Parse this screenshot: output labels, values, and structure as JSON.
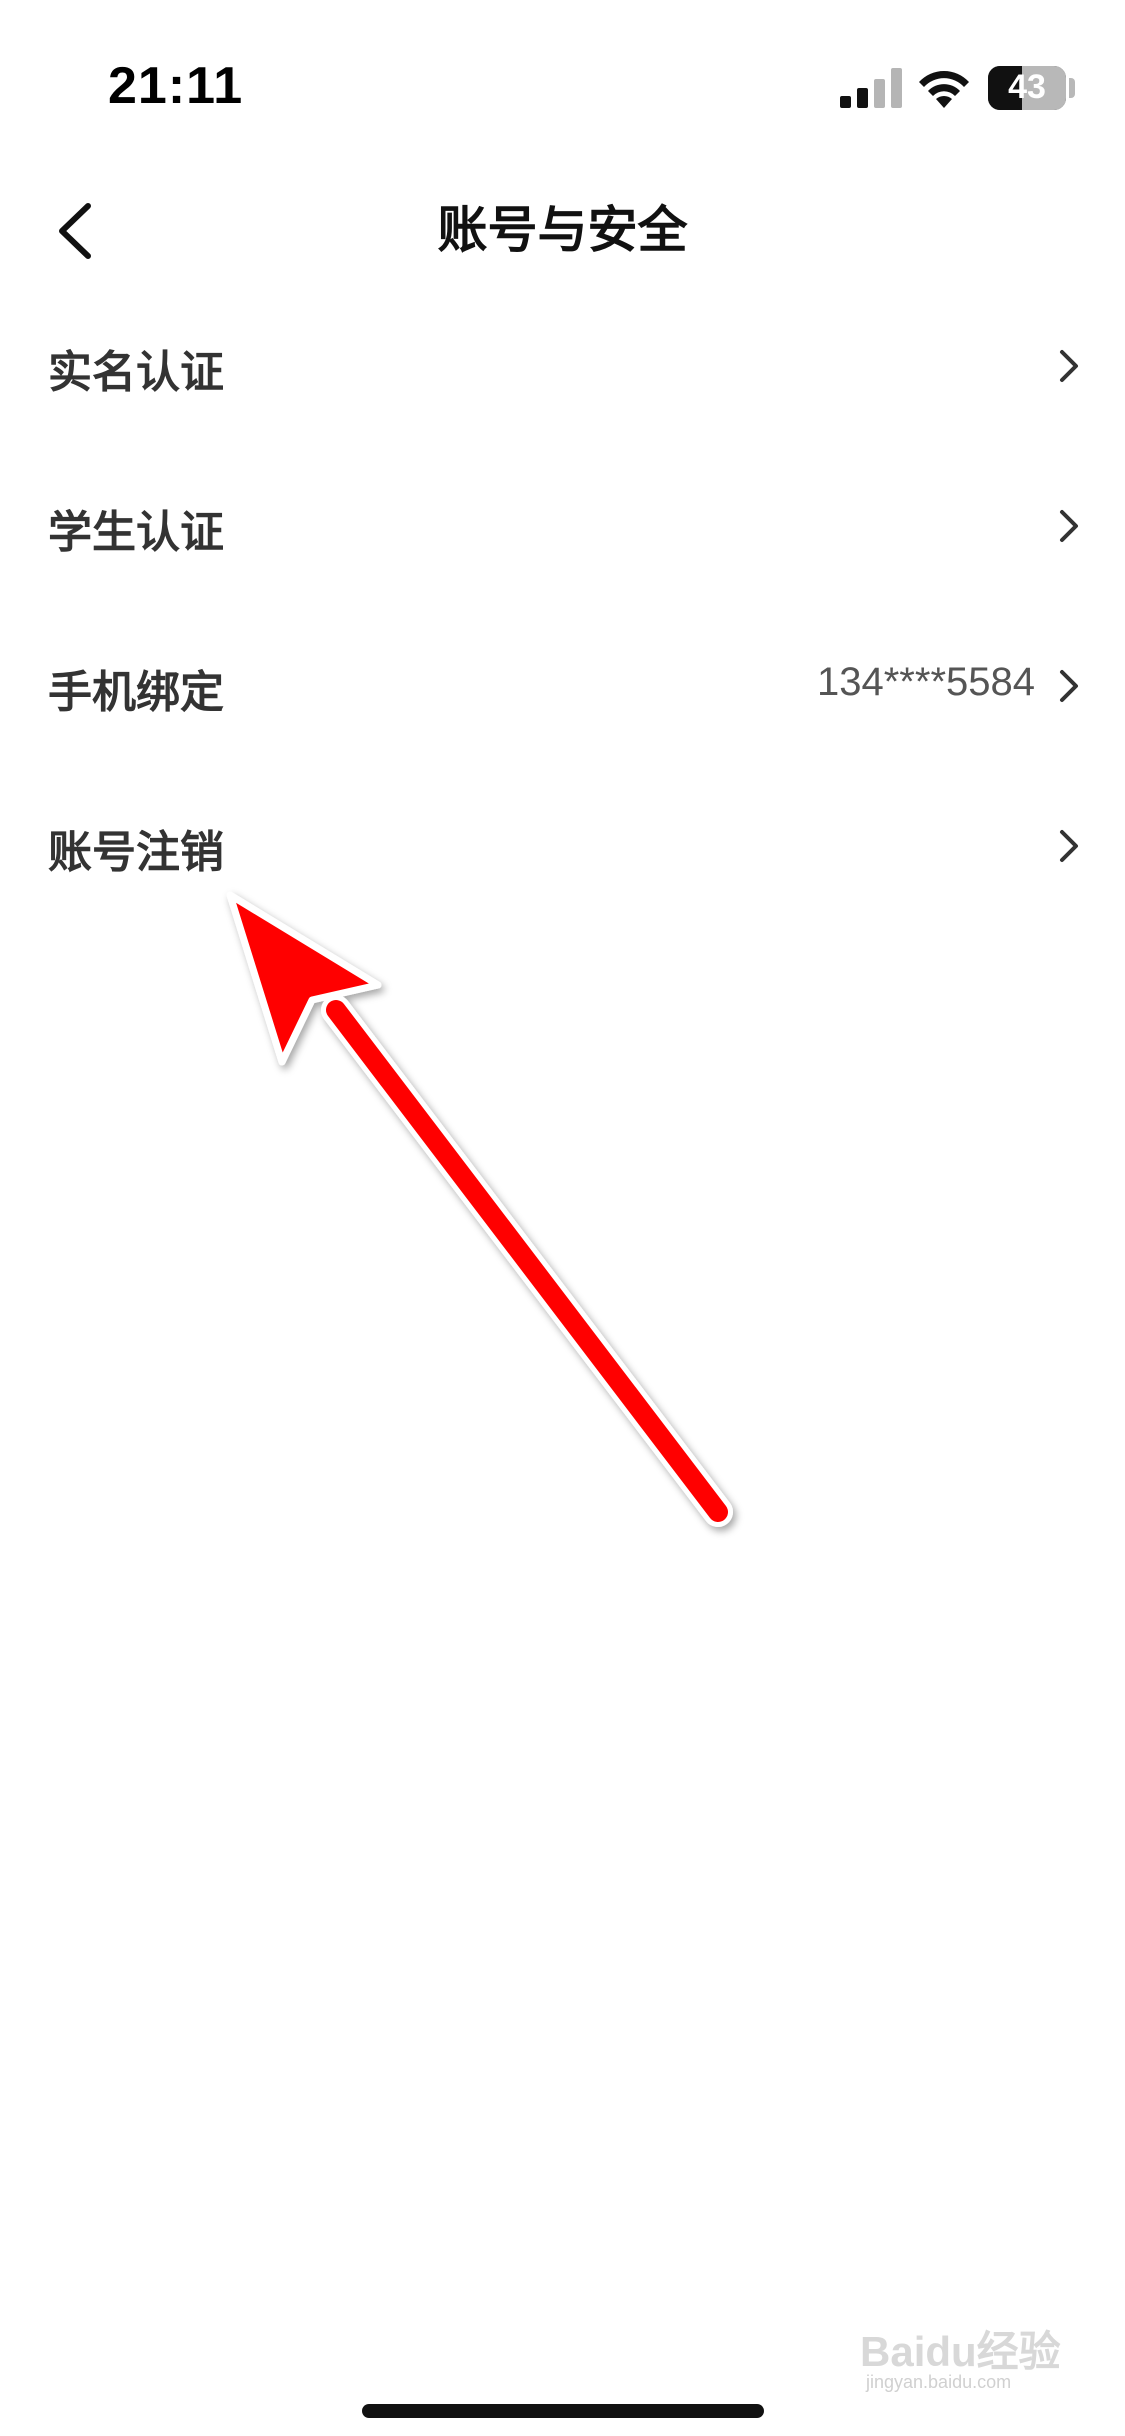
{
  "status_bar": {
    "time": "21:11",
    "battery_text": "43",
    "battery_level_percent": 43,
    "signal_bars_active": 2,
    "signal_bars_total": 4
  },
  "nav": {
    "title": "账号与安全",
    "back_icon": "chevron-left-icon"
  },
  "settings": {
    "items": [
      {
        "label": "实名认证",
        "value": ""
      },
      {
        "label": "学生认证",
        "value": ""
      },
      {
        "label": "手机绑定",
        "value": "134****5584"
      },
      {
        "label": "账号注销",
        "value": ""
      }
    ]
  },
  "annotation": {
    "arrow_color": "#ff0000",
    "arrow_outline_color": "#ffffff",
    "points_to": "账号注销"
  },
  "watermark": {
    "text": "Baidu经验",
    "sub": "jingyan.baidu.com"
  }
}
